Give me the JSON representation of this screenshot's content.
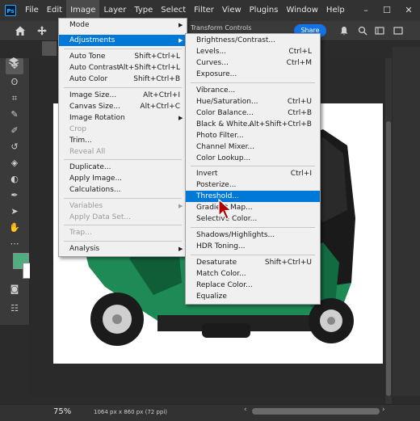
{
  "menubar": {
    "logo": "Ps",
    "items": [
      "File",
      "Edit",
      "Image",
      "Layer",
      "Type",
      "Select",
      "Filter",
      "View",
      "Plugins",
      "Window",
      "Help"
    ],
    "active": "Image"
  },
  "window_controls": {
    "minimize": "–",
    "maximize": "☐",
    "close": "✕"
  },
  "options_bar": {
    "transform_controls": "Transform Controls",
    "share_label": "Share"
  },
  "image_menu": {
    "items": [
      {
        "label": "Mode",
        "submenu": true
      },
      {
        "label": "Adjustments",
        "submenu": true,
        "highlighted": true
      },
      {
        "label": "Auto Tone",
        "shortcut": "Shift+Ctrl+L"
      },
      {
        "label": "Auto Contrast",
        "shortcut": "Alt+Shift+Ctrl+L"
      },
      {
        "label": "Auto Color",
        "shortcut": "Shift+Ctrl+B"
      },
      {
        "label": "Image Size...",
        "shortcut": "Alt+Ctrl+I"
      },
      {
        "label": "Canvas Size...",
        "shortcut": "Alt+Ctrl+C"
      },
      {
        "label": "Image Rotation",
        "submenu": true
      },
      {
        "label": "Crop",
        "disabled": true
      },
      {
        "label": "Trim..."
      },
      {
        "label": "Reveal All",
        "disabled": true
      },
      {
        "label": "Duplicate..."
      },
      {
        "label": "Apply Image..."
      },
      {
        "label": "Calculations..."
      },
      {
        "label": "Variables",
        "submenu": true,
        "disabled": true
      },
      {
        "label": "Apply Data Set...",
        "disabled": true
      },
      {
        "label": "Trap...",
        "disabled": true
      },
      {
        "label": "Analysis",
        "submenu": true
      }
    ]
  },
  "adjustments_menu": {
    "items": [
      {
        "label": "Brightness/Contrast..."
      },
      {
        "label": "Levels...",
        "shortcut": "Ctrl+L"
      },
      {
        "label": "Curves...",
        "shortcut": "Ctrl+M"
      },
      {
        "label": "Exposure..."
      },
      {
        "label": "Vibrance..."
      },
      {
        "label": "Hue/Saturation...",
        "shortcut": "Ctrl+U"
      },
      {
        "label": "Color Balance...",
        "shortcut": "Ctrl+B"
      },
      {
        "label": "Black & White...",
        "shortcut": "Alt+Shift+Ctrl+B"
      },
      {
        "label": "Photo Filter..."
      },
      {
        "label": "Channel Mixer..."
      },
      {
        "label": "Color Lookup..."
      },
      {
        "label": "Invert",
        "shortcut": "Ctrl+I"
      },
      {
        "label": "Posterize..."
      },
      {
        "label": "Threshold...",
        "highlighted": true
      },
      {
        "label": "Gradient Map..."
      },
      {
        "label": "Selective Color..."
      },
      {
        "label": "Shadows/Highlights..."
      },
      {
        "label": "HDR Toning..."
      },
      {
        "label": "Desaturate",
        "shortcut": "Shift+Ctrl+U"
      },
      {
        "label": "Match Color..."
      },
      {
        "label": "Replace Color..."
      },
      {
        "label": "Equalize"
      }
    ]
  },
  "status_bar": {
    "zoom": "75%",
    "doc_info": "1064 px x 860 px (72 ppi)"
  },
  "colors": {
    "foreground": "#4caf7d",
    "background": "#ffffff",
    "menu_highlight": "#0078d7",
    "rickshaw_body": "#1e8a55"
  }
}
